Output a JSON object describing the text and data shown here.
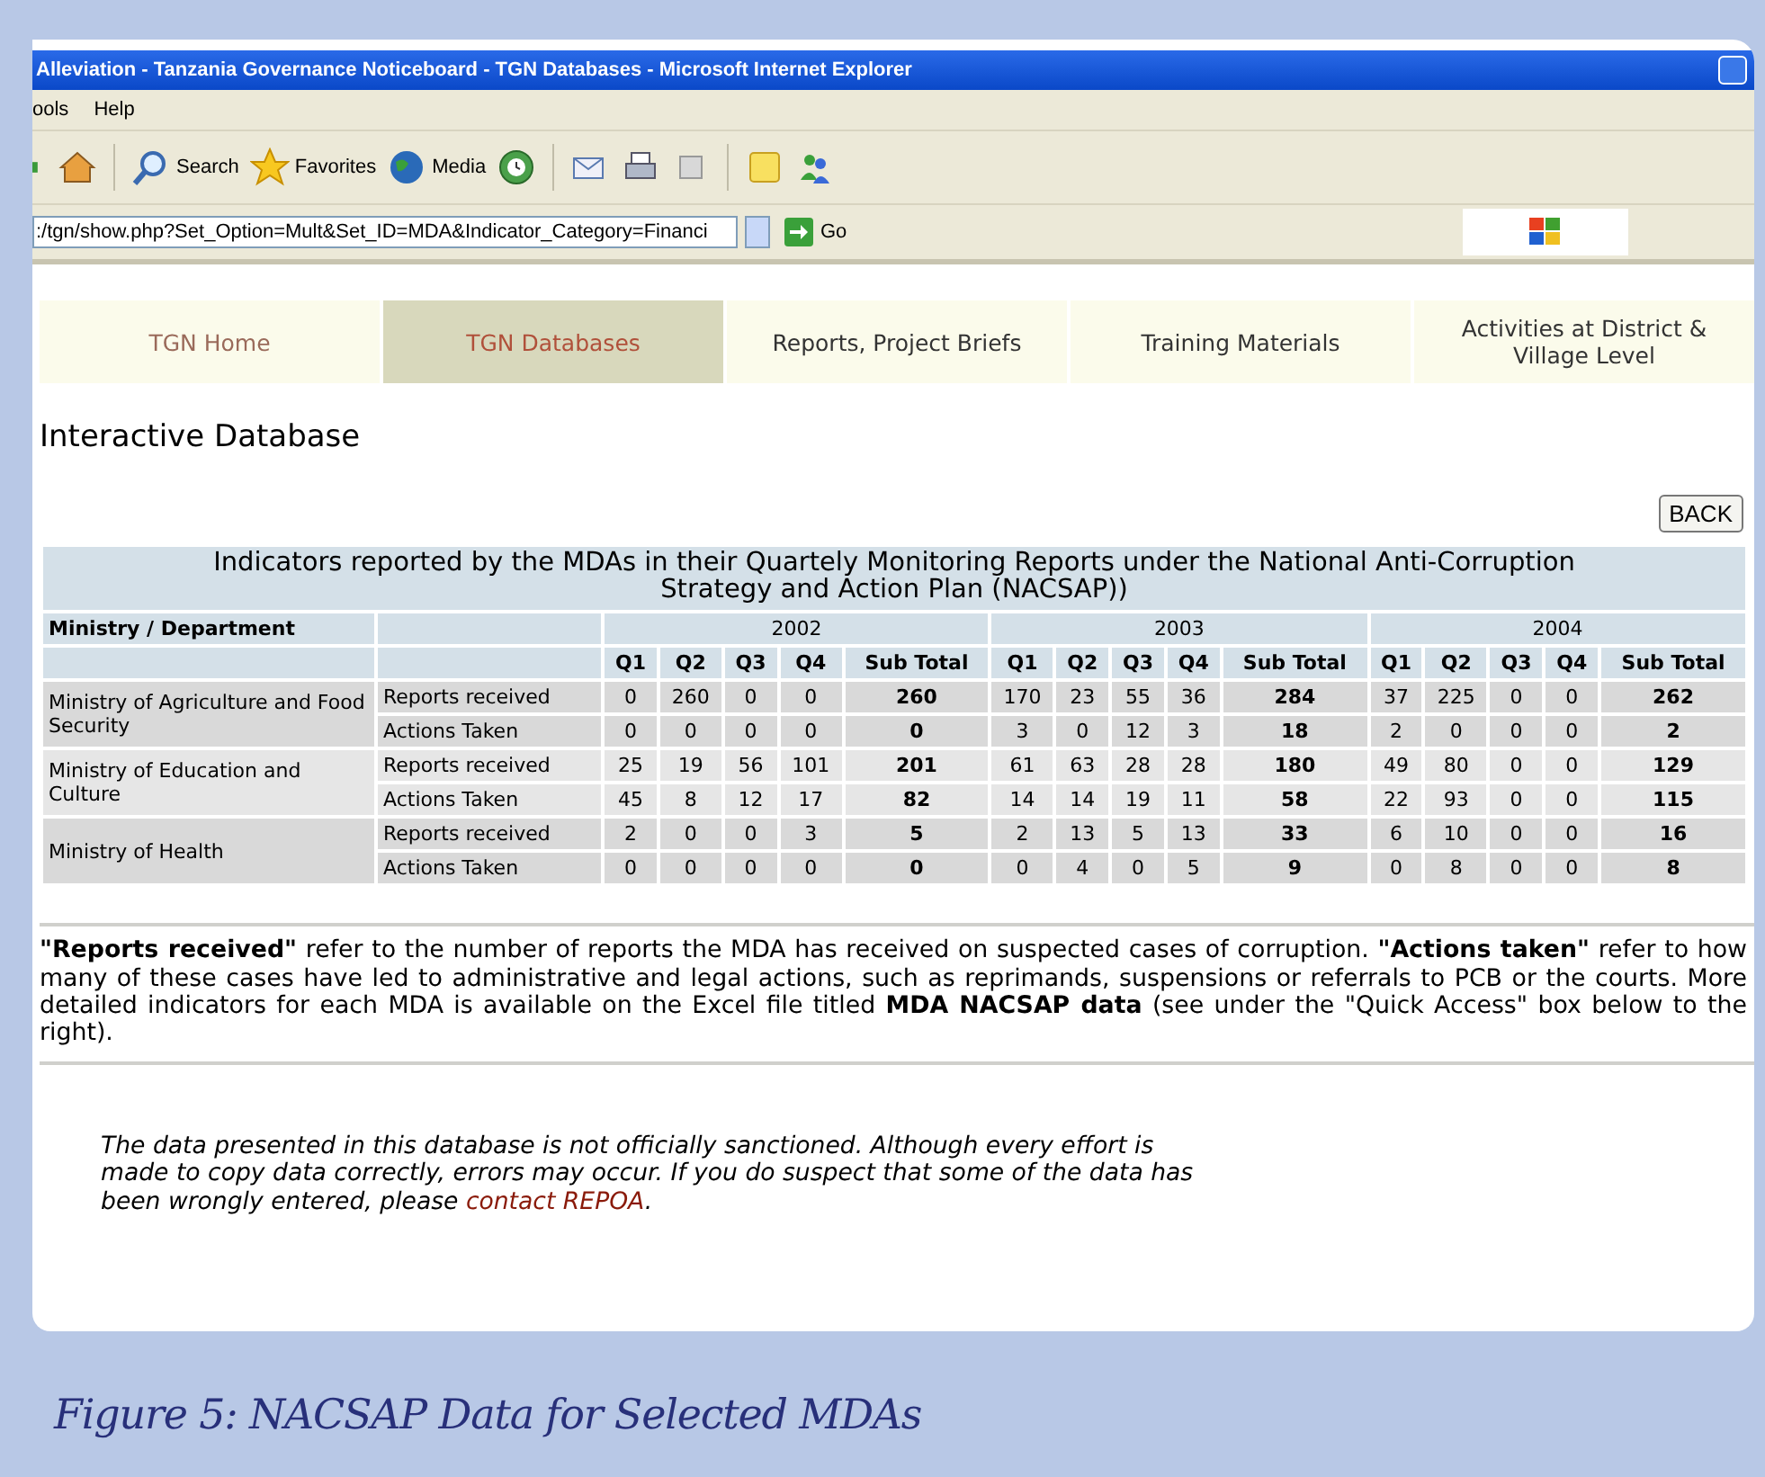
{
  "window": {
    "title": "Alleviation - Tanzania Governance Noticeboard - TGN Databases - Microsoft Internet Explorer"
  },
  "menu": [
    "ools",
    "Help"
  ],
  "toolbar": {
    "labels": [
      "Search",
      "Favorites",
      "Media"
    ]
  },
  "address": {
    "value": ":/tgn/show.php?Set_Option=Mult&Set_ID=MDA&Indicator_Category=Financi",
    "go": "Go"
  },
  "tabs": [
    {
      "label": "TGN Home",
      "selected": false
    },
    {
      "label": "TGN Databases",
      "selected": true
    },
    {
      "label": "Reports, Project Briefs",
      "selected": false
    },
    {
      "label": "Training Materials",
      "selected": false
    },
    {
      "label": "Activities at District & Village Level",
      "selected": false
    }
  ],
  "heading": "Interactive Database",
  "back_button": "BACK",
  "table": {
    "title": "Indicators reported by the MDAs in their Quartely Monitoring Reports under the National Anti-Corruption Strategy and Action Plan (NACSAP))",
    "first_column": "Ministry / Department",
    "years": [
      {
        "label": "2002",
        "columns": [
          {
            "label": "Q1",
            "kind": "quarter"
          },
          {
            "label": "Q2",
            "kind": "quarter"
          },
          {
            "label": "Q3",
            "kind": "quarter"
          },
          {
            "label": "Q4",
            "kind": "quarter"
          },
          {
            "label": "Sub Total",
            "kind": "subtotal"
          }
        ]
      },
      {
        "label": "2003",
        "columns": [
          {
            "label": "Q1",
            "kind": "quarter"
          },
          {
            "label": "Q2",
            "kind": "quarter"
          },
          {
            "label": "Q3",
            "kind": "quarter"
          },
          {
            "label": "Q4",
            "kind": "quarter"
          },
          {
            "label": "Sub Total",
            "kind": "subtotal"
          }
        ]
      },
      {
        "label": "2004",
        "columns": [
          {
            "label": "Q1",
            "kind": "quarter"
          },
          {
            "label": "Q2",
            "kind": "quarter"
          },
          {
            "label": "Q3",
            "kind": "quarter"
          },
          {
            "label": "Q4",
            "kind": "quarter"
          },
          {
            "label": "Sub Total",
            "kind": "subtotal"
          }
        ]
      }
    ],
    "ministries": [
      {
        "name": "Ministry of Agriculture and Food Security",
        "rows": [
          {
            "label": "Reports received",
            "values": [
              "0",
              "260",
              "0",
              "0",
              "260",
              "170",
              "23",
              "55",
              "36",
              "284",
              "37",
              "225",
              "0",
              "0",
              "262"
            ]
          },
          {
            "label": "Actions Taken",
            "values": [
              "0",
              "0",
              "0",
              "0",
              "0",
              "3",
              "0",
              "12",
              "3",
              "18",
              "2",
              "0",
              "0",
              "0",
              "2"
            ]
          }
        ]
      },
      {
        "name": "Ministry of Education and Culture",
        "rows": [
          {
            "label": "Reports received",
            "values": [
              "25",
              "19",
              "56",
              "101",
              "201",
              "61",
              "63",
              "28",
              "28",
              "180",
              "49",
              "80",
              "0",
              "0",
              "129"
            ]
          },
          {
            "label": "Actions Taken",
            "values": [
              "45",
              "8",
              "12",
              "17",
              "82",
              "14",
              "14",
              "19",
              "11",
              "58",
              "22",
              "93",
              "0",
              "0",
              "115"
            ]
          }
        ]
      },
      {
        "name": "Ministry of Health",
        "rows": [
          {
            "label": "Reports received",
            "values": [
              "2",
              "0",
              "0",
              "3",
              "5",
              "2",
              "13",
              "5",
              "13",
              "33",
              "6",
              "10",
              "0",
              "0",
              "16"
            ]
          },
          {
            "label": "Actions Taken",
            "values": [
              "0",
              "0",
              "0",
              "0",
              "0",
              "0",
              "4",
              "0",
              "5",
              "9",
              "0",
              "8",
              "0",
              "0",
              "8"
            ]
          }
        ]
      }
    ]
  },
  "note": "**\"Reports received\"** refer to the number of reports the MDA has received on suspected cases of corruption. **\"Actions taken\"** refer to how many of these cases have led to administrative and legal actions, such as reprimands, suspensions or referrals to PCB or the courts. More detailed indicators for each MDA is available on the Excel file titled **MDA NACSAP data** (see under the \"Quick Access\" box below to the right).",
  "disclaimer": {
    "text": "The data presented in this database is not officially sanctioned. Although every effort is made to copy data correctly, errors may occur. If you do suspect that some of the data has been wrongly entered, please ",
    "link": "contact REPOA",
    "end": "."
  },
  "caption": "Figure 5: NACSAP Data for Selected MDAs"
}
